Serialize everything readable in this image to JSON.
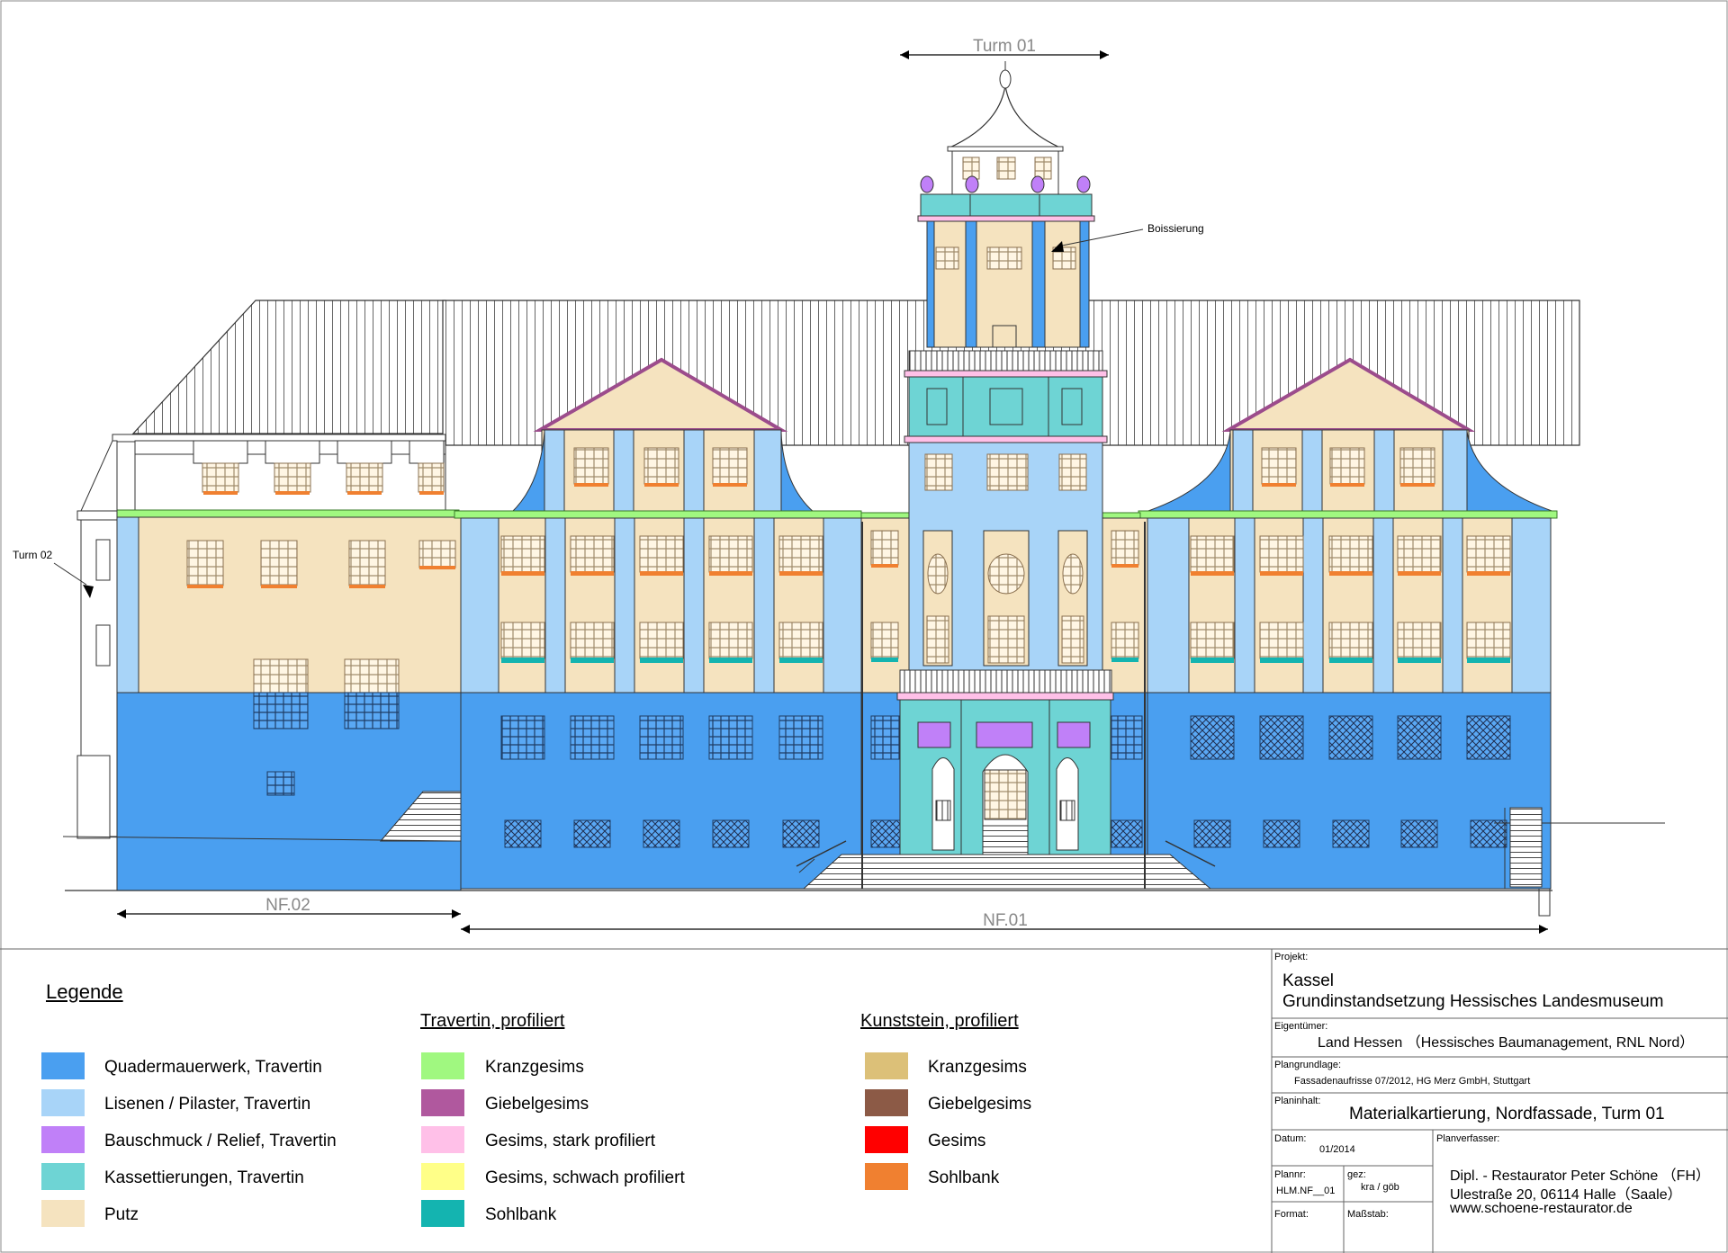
{
  "drawing": {
    "dimension_tower": "Turm  01",
    "dimension_nf02": "NF.02",
    "dimension_nf01": "NF.01",
    "callout_boissierung": "Boissierung",
    "callout_turm02": "Turm 02"
  },
  "legend": {
    "title": "Legende",
    "travertin_heading": "Travertin, profiliert",
    "kunststein_heading": "Kunststein, profiliert",
    "col1": [
      {
        "label": "Quadermauerwerk, Travertin",
        "color": "#4a9ff0"
      },
      {
        "label": " Lisenen / Pilaster, Travertin",
        "color": "#a8d4f8"
      },
      {
        "label": "Bauschmuck / Relief, Travertin",
        "color": "#c080f8"
      },
      {
        "label": "Kassettierungen, Travertin",
        "color": "#6ed4d4"
      },
      {
        "label": "Putz",
        "color": "#f5e3bf"
      }
    ],
    "col2": [
      {
        "label": "Kranzgesims",
        "color": "#a0f880"
      },
      {
        "label": "Giebelgesims",
        "color": "#b0589e"
      },
      {
        "label": "Gesims, stark profiliert",
        "color": "#ffc0e8"
      },
      {
        "label": "Gesims, schwach profiliert",
        "color": "#ffff88"
      },
      {
        "label": "Sohlbank",
        "color": "#14b4b0"
      }
    ],
    "col3": [
      {
        "label": "Kranzgesims",
        "color": "#dcc078"
      },
      {
        "label": "Giebelgesims",
        "color": "#8c5a46"
      },
      {
        "label": "Gesims",
        "color": "#ff0000"
      },
      {
        "label": "Sohlbank",
        "color": "#f08030"
      }
    ]
  },
  "titleblock": {
    "projekt_label": "Projekt:",
    "projekt_line1": "Kassel",
    "projekt_line2": "Grundinstandsetzung Hessisches Landesmuseum",
    "eigentuemer_label": "Eigentümer:",
    "eigentuemer_value": "Land Hessen （Hessisches Baumanagement, RNL Nord）",
    "plangrundlage_label": "Plangrundlage:",
    "plangrundlage_value": "Fassadenaufrisse 07/2012, HG Merz GmbH, Stuttgart",
    "planinhalt_label": "Planinhalt:",
    "planinhalt_value": "Materialkartierung, Nordfassade, Turm 01",
    "datum_label": "Datum:",
    "datum_value": "01/2014",
    "planverfasser_label": "Planverfasser:",
    "plannr_label": "Plannr:",
    "plannr_value": "HLM.NF__01",
    "gez_label": "gez:",
    "gez_value": "kra / göb",
    "format_label": "Format:",
    "massstab_label": "Maßstab:",
    "verfasser_line1": "Dipl. - Restaurator Peter Schöne （FH）",
    "verfasser_line2": "Ulestraße 20, 06114 Halle（Saale）",
    "verfasser_line3": "www.schoene-restaurator.de"
  }
}
